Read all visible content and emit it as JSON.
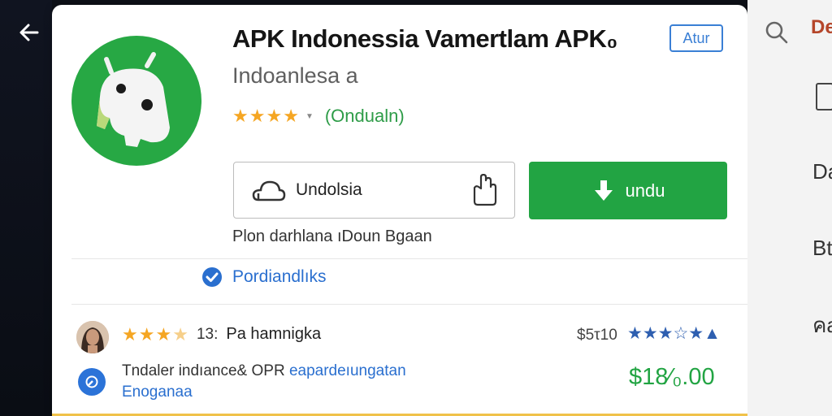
{
  "nav": {
    "back_icon": "back-arrow-icon"
  },
  "app": {
    "title": "APK Indonessia Vamertlam APK₀",
    "subtitle": "Indoanlesa a",
    "rating_stars": 4,
    "rating_link": "(Ondualn)",
    "ad_badge": "Atur",
    "icon": "android-robot-icon",
    "accent_color": "#27a844"
  },
  "actions": {
    "secondary_label": "Undolsia",
    "primary_label": "undu",
    "primary_color": "#22a443"
  },
  "info_line": "Plon darhlana ıDoun Bgaan",
  "verified": {
    "label": "Pordiandlıks",
    "icon": "verified-check-icon"
  },
  "review": {
    "stars": 3.5,
    "count": "13:",
    "name": "Pa hamnigka",
    "price_label": "$5τ10",
    "price_stars": "★★★☆★▲",
    "desc_part1": "Tndaler indıance& ΟPR ",
    "desc_part2": "eapardeıungatan",
    "desc_line2": "Enoganaa",
    "price": "$18∕₀.00"
  },
  "right_panel": {
    "top_text": "De",
    "item1": "Da",
    "item2": "Bt",
    "item3": "คa"
  }
}
